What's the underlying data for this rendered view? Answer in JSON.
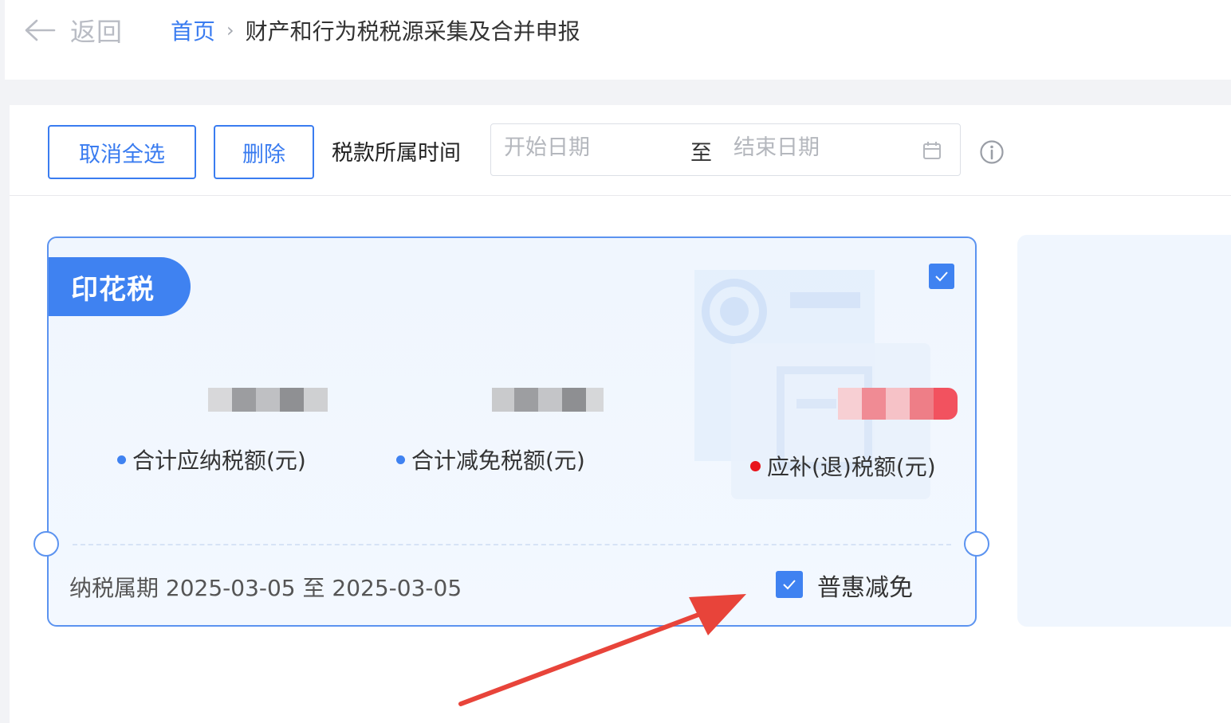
{
  "header": {
    "back_label": "返回",
    "breadcrumb": {
      "home": "首页",
      "separator": "›",
      "current": "财产和行为税税源采集及合并申报"
    }
  },
  "toolbar": {
    "cancel_all_label": "取消全选",
    "delete_label": "删除",
    "period_label": "税款所属时间",
    "date_range": {
      "start_placeholder": "开始日期",
      "separator": "至",
      "end_placeholder": "结束日期"
    }
  },
  "card": {
    "tax_name": "印花税",
    "selected": true,
    "metrics": [
      {
        "label": "合计应纳税额(元)",
        "value_blurred": true
      },
      {
        "label": "合计减免税额(元)",
        "value_blurred": true
      },
      {
        "label": "应补(退)税额(元)",
        "value_blurred": true
      }
    ],
    "period_text": "纳税属期 2025-03-05 至 2025-03-05",
    "discount_checked": true,
    "discount_label": "普惠减免"
  },
  "colors": {
    "accent": "#3f82f1",
    "card_border": "#5b93f0",
    "card_bg": "#f0f6fe",
    "alert_dot": "#e8141c",
    "annotation_arrow": "#e8443a"
  }
}
